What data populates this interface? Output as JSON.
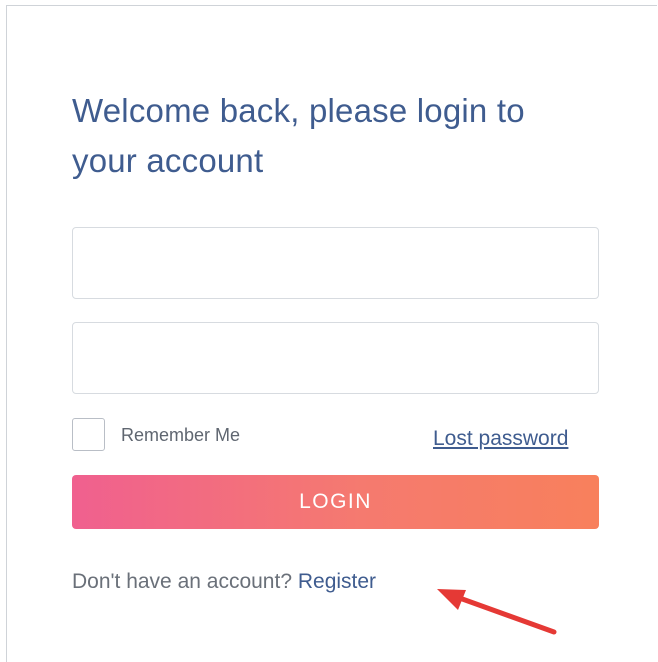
{
  "login": {
    "title": "Welcome back, please login to your account",
    "username_value": "",
    "password_value": "",
    "remember_label": "Remember Me",
    "remember_checked": false,
    "lost_password_label": "Lost password",
    "login_button_label": "LOGIN",
    "no_account_text": "Don't have an account?",
    "register_label": "Register"
  },
  "annotation": {
    "icon": "arrow-icon",
    "color": "#e53935"
  }
}
